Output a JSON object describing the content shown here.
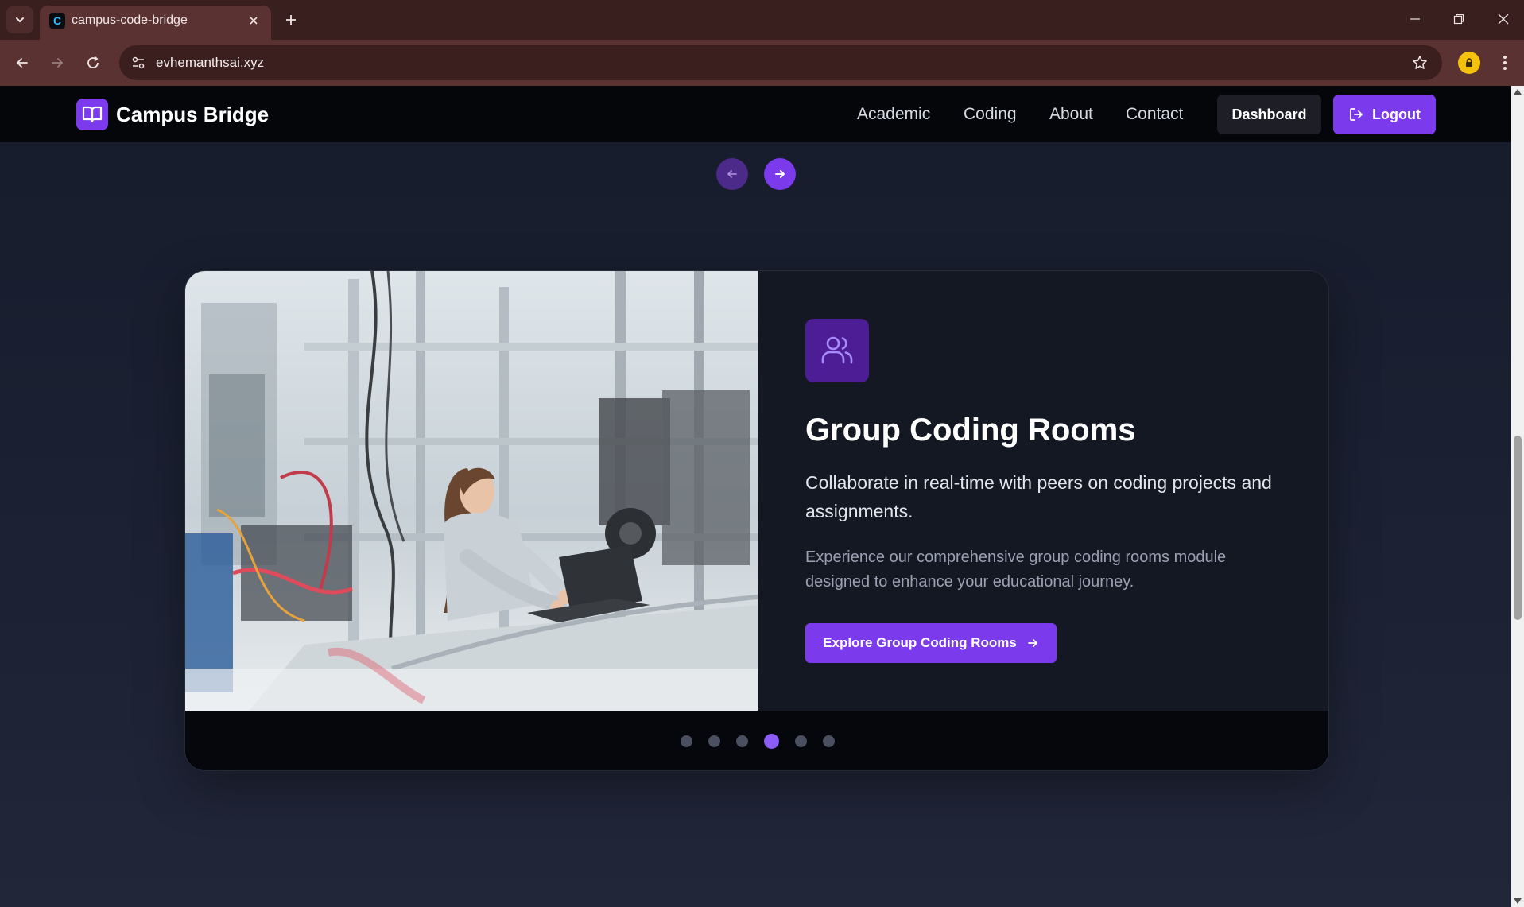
{
  "browser": {
    "tab_title": "campus-code-bridge",
    "favicon_letter": "C",
    "url": "evhemanthsai.xyz",
    "icons": [
      "tab-list-icon",
      "close-icon",
      "plus-icon",
      "minimize-icon",
      "restore-icon",
      "close-window-icon",
      "back-arrow-icon",
      "forward-arrow-icon",
      "reload-icon",
      "site-info-icon",
      "star-icon",
      "profile-icon",
      "kebab-menu-icon"
    ]
  },
  "site": {
    "brand": "Campus Bridge",
    "nav": [
      "Academic",
      "Coding",
      "About",
      "Contact"
    ],
    "dashboard_label": "Dashboard",
    "logout_label": "Logout",
    "accent_color": "#7c3aed"
  },
  "slide": {
    "title": "Group Coding Rooms",
    "lead": "Collaborate in real-time with peers on coding projects and assignments.",
    "description": "Experience our comprehensive group coding rooms module designed to enhance your educational journey.",
    "cta_label": "Explore Group Coding Rooms",
    "icon": "users-icon",
    "image": "woman-working-on-laptop-in-lab-photo"
  },
  "carousel": {
    "total_slides": 6,
    "active_index": 4
  }
}
